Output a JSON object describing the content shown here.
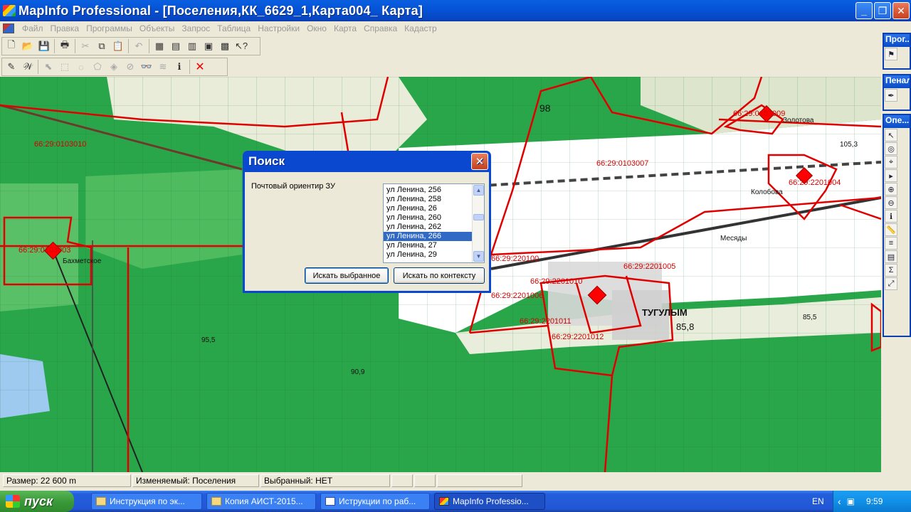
{
  "window": {
    "title": "MapInfo Professional - [Поселения,КК_6629_1,Карта004_ Карта]",
    "minimize": "_",
    "restore": "❐",
    "close": "✕"
  },
  "menu": [
    "Файл",
    "Правка",
    "Программы",
    "Объекты",
    "Запрос",
    "Таблица",
    "Настройки",
    "Окно",
    "Карта",
    "Справка",
    "Кадастр"
  ],
  "toolbar1": [
    "new-icon",
    "open-icon",
    "save-icon",
    "print-icon",
    "cut-icon",
    "copy-icon",
    "paste-icon",
    "undo-icon",
    "browser-icon",
    "map-icon",
    "graph-icon",
    "layout-icon",
    "redistrict-icon",
    "help-icon"
  ],
  "toolbar2": [
    "edit-icon",
    "label-icon",
    "select-icon",
    "rect-select-icon",
    "radius-select-icon",
    "polygon-select-icon",
    "boundary-select-icon",
    "unselect-icon",
    "find-icon",
    "layer-icon",
    "info-icon",
    "delete-icon"
  ],
  "palettes": [
    {
      "title": "Прог..."
    },
    {
      "title": "Пенал"
    },
    {
      "title": "Опе..."
    }
  ],
  "map": {
    "labels": [
      {
        "text": "66:29:0103010"
      },
      {
        "text": "66:29:0103007"
      },
      {
        "text": "66:29:2201005"
      },
      {
        "text": "66:29:2201006"
      },
      {
        "text": "66:29:2201011"
      },
      {
        "text": "66:29:2201012"
      },
      {
        "text": "66:29:220100"
      },
      {
        "text": "66:29:2201010"
      },
      {
        "text": "66:29:2201004"
      },
      {
        "text": "66:29:0103003"
      },
      {
        "text": "66:29:0103009"
      }
    ],
    "places": [
      "Бахметское",
      "ТУГУЛЫМ",
      "Колобова",
      "Золотова",
      "Месяды",
      "85,8",
      "85,5",
      "105,3",
      "95,5",
      "90,9",
      "98"
    ]
  },
  "dialog": {
    "title": "Поиск",
    "close": "✕",
    "label": "Почтовый ориентир ЗУ",
    "items": [
      "ул Ленина, 256",
      "ул Ленина, 258",
      "ул Ленина, 26",
      "ул Ленина, 260",
      "ул Ленина, 262",
      "ул Ленина, 266",
      "ул Ленина, 27",
      "ул Ленина, 29"
    ],
    "selected_index": 5,
    "button_find_selected": "Искать выбранное",
    "button_find_context": "Искать по контексту"
  },
  "status": {
    "size": "Размер: 22 600 m",
    "editable": "Изменяемый: Поселения",
    "selected": "Выбранный: НЕТ"
  },
  "taskbar": {
    "start": "пуск",
    "tasks": [
      "Инструкция по эк...",
      "Копия АИСТ-2015...",
      "Иструкции по раб...",
      "MapInfo Professio..."
    ],
    "lang": "EN",
    "clock": "9:59"
  },
  "colors": {
    "boundary": "#e00000",
    "map_forest": "#2aa64a",
    "selection": "#316ac5"
  }
}
